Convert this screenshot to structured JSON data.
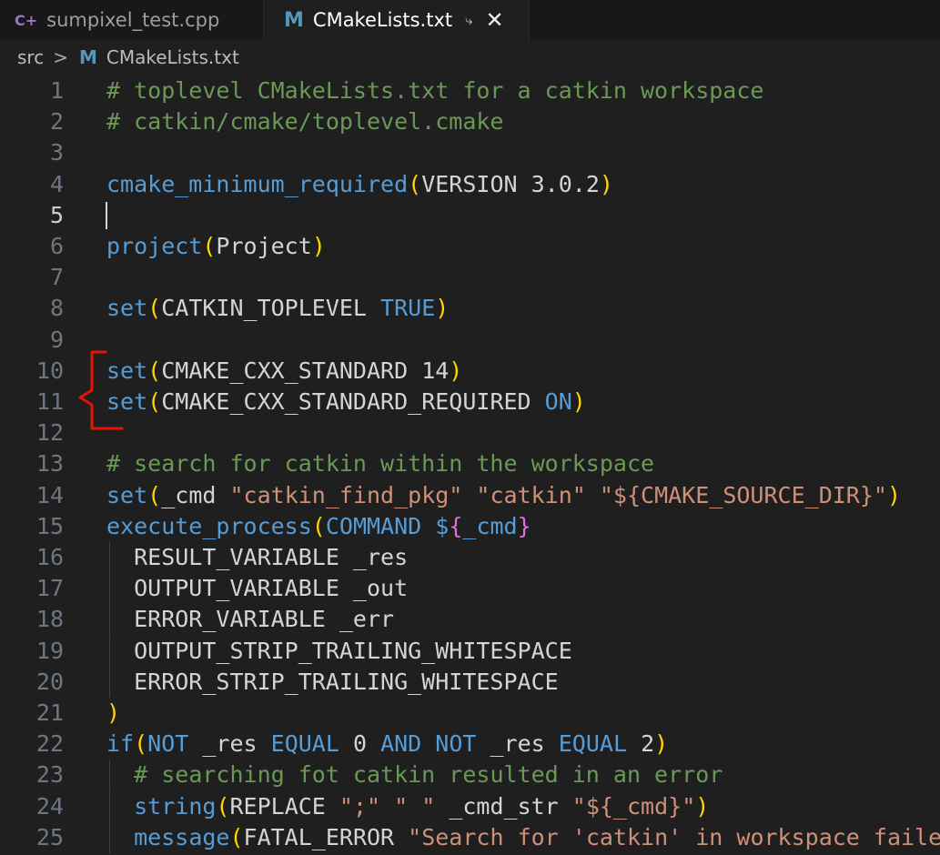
{
  "tabs": [
    {
      "label": "sumpixel_test.cpp",
      "icon": "cpp-file-icon",
      "glyph": "C+",
      "active": false
    },
    {
      "label": "CMakeLists.txt",
      "icon": "cmake-file-icon",
      "glyph": "M",
      "active": true,
      "split_glyph": "⤷",
      "close_glyph": "✕"
    }
  ],
  "breadcrumb": {
    "folder": "src",
    "separator": ">",
    "file_glyph": "M",
    "file": "CMakeLists.txt"
  },
  "colors": {
    "comment": "#6a9955",
    "function": "#569cd6",
    "paren": "#ffd700",
    "string": "#ce9178",
    "text": "#d4d4d4",
    "annotation": "#e51400"
  },
  "editor": {
    "current_line": 5,
    "lines": [
      {
        "n": "1",
        "tokens": [
          [
            "comment",
            "# toplevel CMakeLists.txt for a catkin workspace"
          ]
        ]
      },
      {
        "n": "2",
        "tokens": [
          [
            "comment",
            "# catkin/cmake/toplevel.cmake"
          ]
        ]
      },
      {
        "n": "3",
        "tokens": []
      },
      {
        "n": "4",
        "tokens": [
          [
            "func",
            "cmake_minimum_required"
          ],
          [
            "paren",
            "("
          ],
          [
            "plain",
            "VERSION 3.0.2"
          ],
          [
            "paren",
            ")"
          ]
        ]
      },
      {
        "n": "5",
        "tokens": []
      },
      {
        "n": "6",
        "tokens": [
          [
            "func",
            "project"
          ],
          [
            "paren",
            "("
          ],
          [
            "plain",
            "Project"
          ],
          [
            "paren",
            ")"
          ]
        ]
      },
      {
        "n": "7",
        "tokens": []
      },
      {
        "n": "8",
        "tokens": [
          [
            "func",
            "set"
          ],
          [
            "paren",
            "("
          ],
          [
            "plain",
            "CATKIN_TOPLEVEL "
          ],
          [
            "keyword",
            "TRUE"
          ],
          [
            "paren",
            ")"
          ]
        ]
      },
      {
        "n": "9",
        "tokens": []
      },
      {
        "n": "10",
        "tokens": [
          [
            "func",
            "set"
          ],
          [
            "paren",
            "("
          ],
          [
            "plain",
            "CMAKE_CXX_STANDARD 14"
          ],
          [
            "paren",
            ")"
          ]
        ]
      },
      {
        "n": "11",
        "tokens": [
          [
            "func",
            "set"
          ],
          [
            "paren",
            "("
          ],
          [
            "plain",
            "CMAKE_CXX_STANDARD_REQUIRED "
          ],
          [
            "keyword",
            "ON"
          ],
          [
            "paren",
            ")"
          ]
        ]
      },
      {
        "n": "12",
        "tokens": []
      },
      {
        "n": "13",
        "tokens": [
          [
            "comment",
            "# search for catkin within the workspace"
          ]
        ]
      },
      {
        "n": "14",
        "tokens": [
          [
            "func",
            "set"
          ],
          [
            "paren",
            "("
          ],
          [
            "plain",
            "_cmd "
          ],
          [
            "string",
            "\"catkin_find_pkg\" \"catkin\" \"${CMAKE_SOURCE_DIR}\""
          ],
          [
            "paren",
            ")"
          ]
        ]
      },
      {
        "n": "15",
        "tokens": [
          [
            "func",
            "execute_process"
          ],
          [
            "paren",
            "("
          ],
          [
            "keyword",
            "COMMAND"
          ],
          [
            "plain",
            " "
          ],
          [
            "func",
            "$"
          ],
          [
            "bracket2",
            "{"
          ],
          [
            "func",
            "_cmd"
          ],
          [
            "bracket2",
            "}"
          ]
        ]
      },
      {
        "n": "16",
        "indent": true,
        "tokens": [
          [
            "plain",
            "  RESULT_VARIABLE _res"
          ]
        ]
      },
      {
        "n": "17",
        "indent": true,
        "tokens": [
          [
            "plain",
            "  OUTPUT_VARIABLE _out"
          ]
        ]
      },
      {
        "n": "18",
        "indent": true,
        "tokens": [
          [
            "plain",
            "  ERROR_VARIABLE _err"
          ]
        ]
      },
      {
        "n": "19",
        "indent": true,
        "tokens": [
          [
            "plain",
            "  OUTPUT_STRIP_TRAILING_WHITESPACE"
          ]
        ]
      },
      {
        "n": "20",
        "indent": true,
        "tokens": [
          [
            "plain",
            "  ERROR_STRIP_TRAILING_WHITESPACE"
          ]
        ]
      },
      {
        "n": "21",
        "tokens": [
          [
            "paren",
            ")"
          ]
        ]
      },
      {
        "n": "22",
        "tokens": [
          [
            "func",
            "if"
          ],
          [
            "paren",
            "("
          ],
          [
            "keyword",
            "NOT"
          ],
          [
            "plain",
            " _res "
          ],
          [
            "keyword",
            "EQUAL"
          ],
          [
            "plain",
            " 0 "
          ],
          [
            "keyword",
            "AND"
          ],
          [
            "plain",
            " "
          ],
          [
            "keyword",
            "NOT"
          ],
          [
            "plain",
            " _res "
          ],
          [
            "keyword",
            "EQUAL"
          ],
          [
            "plain",
            " 2"
          ],
          [
            "paren",
            ")"
          ]
        ]
      },
      {
        "n": "23",
        "indent": true,
        "tokens": [
          [
            "plain",
            "  "
          ],
          [
            "comment",
            "# searching fot catkin resulted in an error"
          ]
        ]
      },
      {
        "n": "24",
        "indent": true,
        "tokens": [
          [
            "plain",
            "  "
          ],
          [
            "func",
            "string"
          ],
          [
            "paren",
            "("
          ],
          [
            "plain",
            "REPLACE "
          ],
          [
            "string",
            "\";\" \" \""
          ],
          [
            "plain",
            " _cmd_str "
          ],
          [
            "string",
            "\"${_cmd}\""
          ],
          [
            "paren",
            ")"
          ]
        ]
      },
      {
        "n": "25",
        "indent": true,
        "tokens": [
          [
            "plain",
            "  "
          ],
          [
            "func",
            "message"
          ],
          [
            "paren",
            "("
          ],
          [
            "plain",
            "FATAL_ERROR "
          ],
          [
            "string",
            "\"Search for 'catkin' in workspace failed"
          ]
        ]
      }
    ]
  }
}
